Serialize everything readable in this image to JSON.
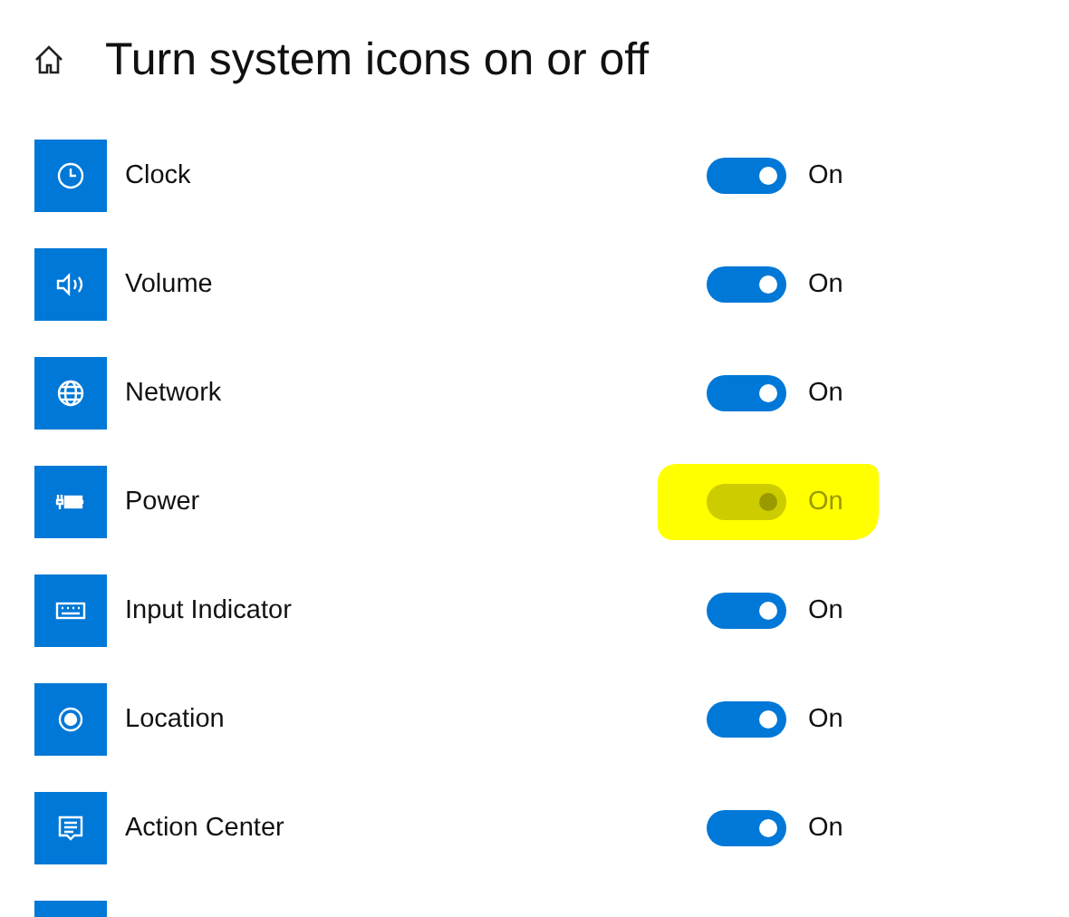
{
  "header": {
    "title": "Turn system icons on or off"
  },
  "items": [
    {
      "kind": "clock",
      "label": "Clock",
      "on": true,
      "disabled": false,
      "state_label": "On",
      "highlighted": false
    },
    {
      "kind": "volume",
      "label": "Volume",
      "on": true,
      "disabled": false,
      "state_label": "On",
      "highlighted": false
    },
    {
      "kind": "network",
      "label": "Network",
      "on": true,
      "disabled": false,
      "state_label": "On",
      "highlighted": false
    },
    {
      "kind": "power",
      "label": "Power",
      "on": true,
      "disabled": true,
      "state_label": "On",
      "highlighted": true
    },
    {
      "kind": "keyboard",
      "label": "Input Indicator",
      "on": true,
      "disabled": false,
      "state_label": "On",
      "highlighted": false
    },
    {
      "kind": "location",
      "label": "Location",
      "on": true,
      "disabled": false,
      "state_label": "On",
      "highlighted": false
    },
    {
      "kind": "message",
      "label": "Action Center",
      "on": true,
      "disabled": false,
      "state_label": "On",
      "highlighted": false
    },
    {
      "kind": "partial"
    }
  ]
}
